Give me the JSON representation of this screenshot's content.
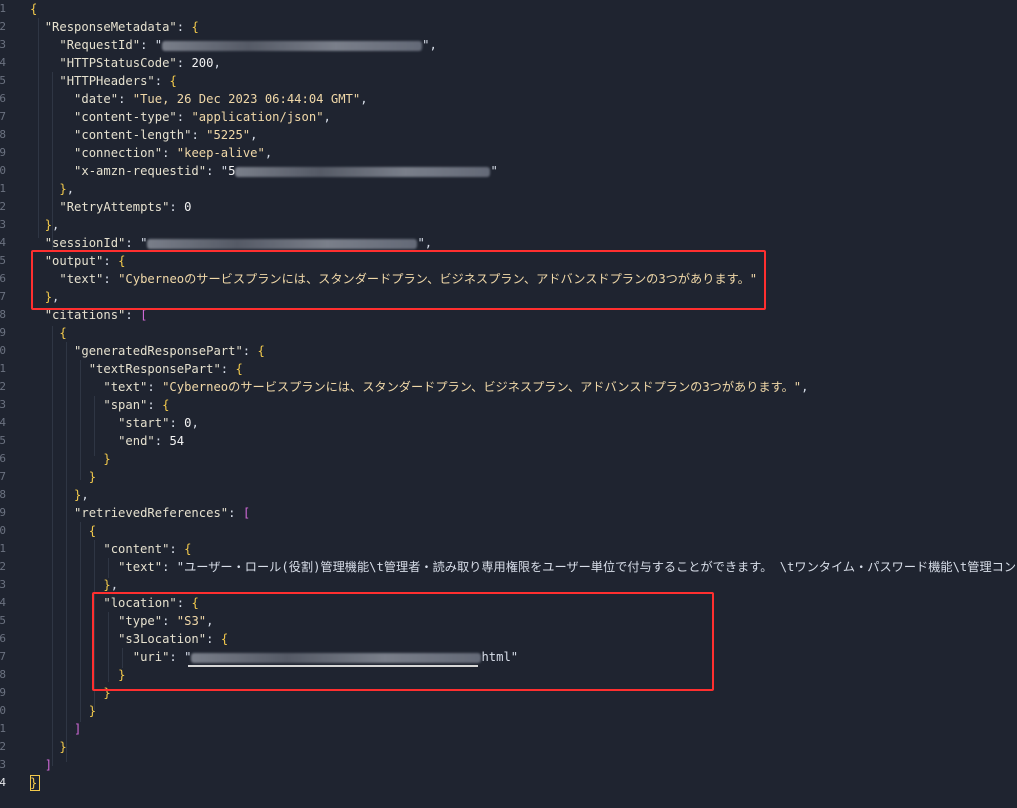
{
  "theme": {
    "background": "#1f2430",
    "key_color": "#e6e1cf",
    "string_color": "#f0d8a8",
    "bracket_yellow": "#f2c94c",
    "bracket_purple": "#d16ad8",
    "bracket_blue": "#4aa3ff",
    "highlight_red": "#ff2f2f"
  },
  "editor": {
    "line_numbers": [
      "1",
      "2",
      "3",
      "4",
      "5",
      "6",
      "7",
      "8",
      "9",
      "0",
      "1",
      "2",
      "3",
      "4",
      "5",
      "6",
      "7",
      "8",
      "9",
      "0",
      "1",
      "2",
      "3",
      "4",
      "5",
      "6",
      "7",
      "8",
      "9",
      "0",
      "1",
      "2",
      "3",
      "4",
      "5",
      "6",
      "7",
      "8",
      "9",
      "0",
      "1",
      "2",
      "3",
      "4"
    ],
    "active_line_number": "4",
    "lines": [
      [
        "{"
      ],
      [
        "  \"ResponseMetadata\": {"
      ],
      [
        "    \"RequestId\": \"",
        "",
        "\","
      ],
      [
        "    \"HTTPStatusCode\": 200,"
      ],
      [
        "    \"HTTPHeaders\": {"
      ],
      [
        "      \"date\": \"Tue, 26 Dec 2023 06:44:04 GMT\","
      ],
      [
        "      \"content-type\": \"application/json\","
      ],
      [
        "      \"content-length\": \"5225\","
      ],
      [
        "      \"connection\": \"keep-alive\","
      ],
      [
        "      \"x-amzn-requestid\": \"5",
        "",
        "\""
      ],
      [
        "    },"
      ],
      [
        "    \"RetryAttempts\": 0"
      ],
      [
        "  },"
      ],
      [
        "  \"sessionId\": \"",
        "",
        "\","
      ],
      [
        "  \"output\": {"
      ],
      [
        "    \"text\": \"Cyberneoのサービスプランには、スタンダードプラン、ビジネスプラン、アドバンスドプランの3つがあります。\""
      ],
      [
        "  },"
      ],
      [
        "  \"citations\": ["
      ],
      [
        "    {"
      ],
      [
        "      \"generatedResponsePart\": {"
      ],
      [
        "        \"textResponsePart\": {"
      ],
      [
        "          \"text\": \"Cyberneoのサービスプランには、スタンダードプラン、ビジネスプラン、アドバンスドプランの3つがあります。\","
      ],
      [
        "          \"span\": {"
      ],
      [
        "            \"start\": 0,"
      ],
      [
        "            \"end\": 54"
      ],
      [
        "          }"
      ],
      [
        "        }"
      ],
      [
        "      },"
      ],
      [
        "      \"retrievedReferences\": ["
      ],
      [
        "        {"
      ],
      [
        "          \"content\": {"
      ],
      [
        "            \"text\": \"ユーザー・ロール(役割)管理機能\\t管理者・読み取り専用権限をユーザー単位で付与することができます。 \\tワンタイム・パスワード機能\\t管理コンソ"
      ],
      [
        "          },"
      ],
      [
        "          \"location\": {"
      ],
      [
        "            \"type\": \"S3\","
      ],
      [
        "            \"s3Location\": {"
      ],
      [
        "              \"uri\": \"",
        "",
        "html\""
      ],
      [
        "            }"
      ],
      [
        "          }"
      ],
      [
        "        }"
      ],
      [
        "      ]"
      ],
      [
        "    }"
      ],
      [
        "  ]"
      ],
      [
        "}"
      ]
    ]
  }
}
